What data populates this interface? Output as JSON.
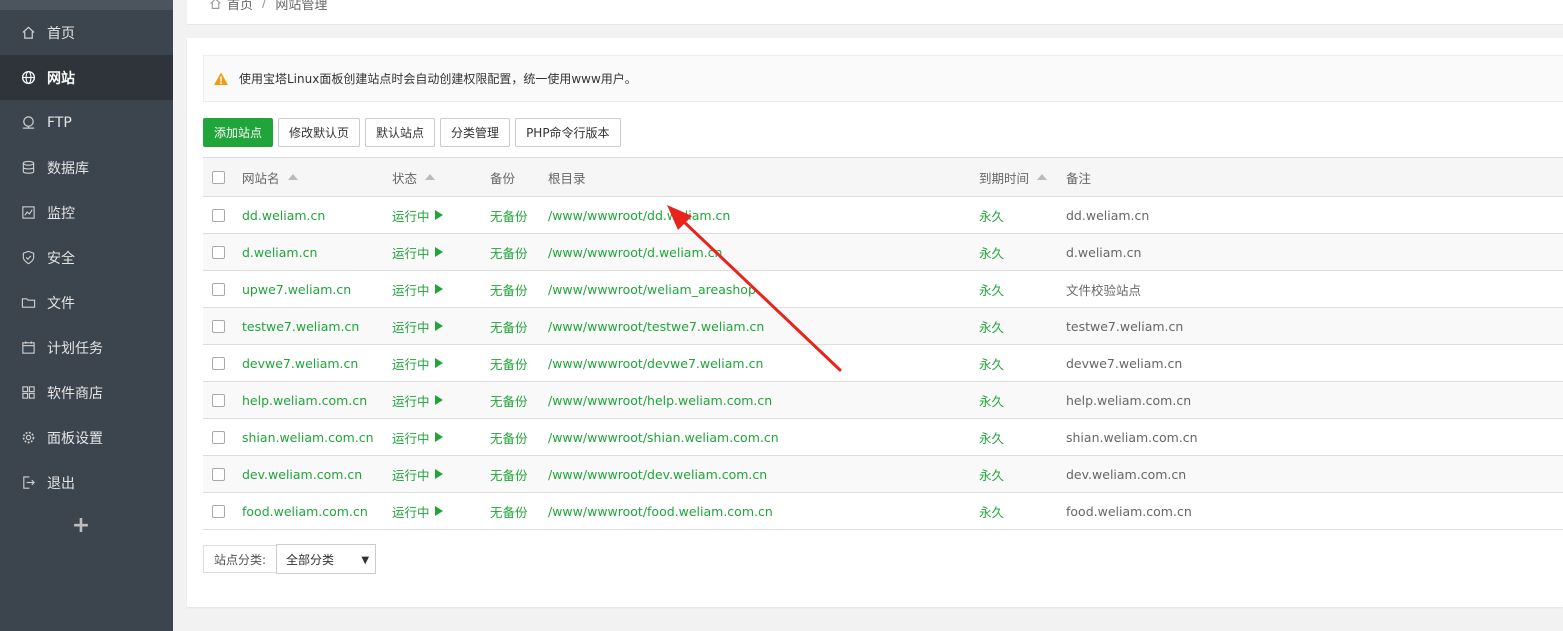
{
  "sidebar": {
    "items": [
      {
        "label": "首页",
        "icon": "home-icon"
      },
      {
        "label": "网站",
        "icon": "globe-icon",
        "active": true
      },
      {
        "label": "FTP",
        "icon": "ftp-icon"
      },
      {
        "label": "数据库",
        "icon": "database-icon"
      },
      {
        "label": "监控",
        "icon": "monitor-icon"
      },
      {
        "label": "安全",
        "icon": "shield-icon"
      },
      {
        "label": "文件",
        "icon": "folder-icon"
      },
      {
        "label": "计划任务",
        "icon": "calendar-icon"
      },
      {
        "label": "软件商店",
        "icon": "grid-icon"
      },
      {
        "label": "面板设置",
        "icon": "gear-icon"
      },
      {
        "label": "退出",
        "icon": "logout-icon"
      }
    ],
    "add_label": "+"
  },
  "breadcrumb": {
    "home": "首页",
    "separator": "/",
    "current": "网站管理"
  },
  "alert": {
    "text": "使用宝塔Linux面板创建站点时会自动创建权限配置，统一使用www用户。"
  },
  "toolbar": {
    "add_site": "添加站点",
    "edit_default_page": "修改默认页",
    "default_site": "默认站点",
    "category_manage": "分类管理",
    "php_cli_version": "PHP命令行版本"
  },
  "table": {
    "headers": {
      "name": "网站名",
      "status": "状态",
      "backup": "备份",
      "root": "根目录",
      "expire": "到期时间",
      "note": "备注"
    },
    "rows": [
      {
        "name": "dd.weliam.cn",
        "status": "运行中",
        "backup": "无备份",
        "root": "/www/wwwroot/dd.weliam.cn",
        "expire": "永久",
        "note": "dd.weliam.cn"
      },
      {
        "name": "d.weliam.cn",
        "status": "运行中",
        "backup": "无备份",
        "root": "/www/wwwroot/d.weliam.cn",
        "expire": "永久",
        "note": "d.weliam.cn"
      },
      {
        "name": "upwe7.weliam.cn",
        "status": "运行中",
        "backup": "无备份",
        "root": "/www/wwwroot/weliam_areashop",
        "expire": "永久",
        "note": "文件校验站点"
      },
      {
        "name": "testwe7.weliam.cn",
        "status": "运行中",
        "backup": "无备份",
        "root": "/www/wwwroot/testwe7.weliam.cn",
        "expire": "永久",
        "note": "testwe7.weliam.cn"
      },
      {
        "name": "devwe7.weliam.cn",
        "status": "运行中",
        "backup": "无备份",
        "root": "/www/wwwroot/devwe7.weliam.cn",
        "expire": "永久",
        "note": "devwe7.weliam.cn"
      },
      {
        "name": "help.weliam.com.cn",
        "status": "运行中",
        "backup": "无备份",
        "root": "/www/wwwroot/help.weliam.com.cn",
        "expire": "永久",
        "note": "help.weliam.com.cn"
      },
      {
        "name": "shian.weliam.com.cn",
        "status": "运行中",
        "backup": "无备份",
        "root": "/www/wwwroot/shian.weliam.com.cn",
        "expire": "永久",
        "note": "shian.weliam.com.cn"
      },
      {
        "name": "dev.weliam.com.cn",
        "status": "运行中",
        "backup": "无备份",
        "root": "/www/wwwroot/dev.weliam.com.cn",
        "expire": "永久",
        "note": "dev.weliam.com.cn"
      },
      {
        "name": "food.weliam.com.cn",
        "status": "运行中",
        "backup": "无备份",
        "root": "/www/wwwroot/food.weliam.com.cn",
        "expire": "永久",
        "note": "food.weliam.com.cn"
      }
    ]
  },
  "footer": {
    "category_label": "站点分类:",
    "category_value": "全部分类"
  },
  "colors": {
    "accent": "#20a53a",
    "sidebar_bg": "#3c444d",
    "annotation_arrow": "#e8241c",
    "warning": "#f39c12"
  }
}
